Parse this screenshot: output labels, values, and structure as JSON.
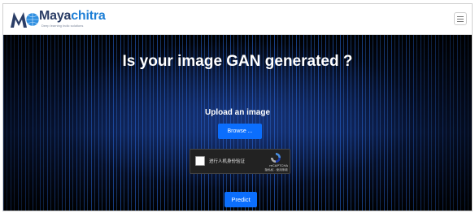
{
  "navbar": {
    "brand_prefix": "Maya",
    "brand_suffix": "chitra",
    "tagline": "Deep learning Indic solutions",
    "menu_icon": "hamburger-menu-icon"
  },
  "hero": {
    "title": "Is your image GAN generated ?",
    "upload_label": "Upload an image",
    "browse_label": "Browse ...",
    "predict_label": "Predict"
  },
  "captcha": {
    "checkbox_label": "进行人机身份验证",
    "brand": "reCAPTCHA",
    "links": "隐私权 - 使用条款"
  },
  "colors": {
    "button": "#0b6efd",
    "brand_dark": "#2a3d66",
    "brand_accent": "#1e7fd6"
  }
}
